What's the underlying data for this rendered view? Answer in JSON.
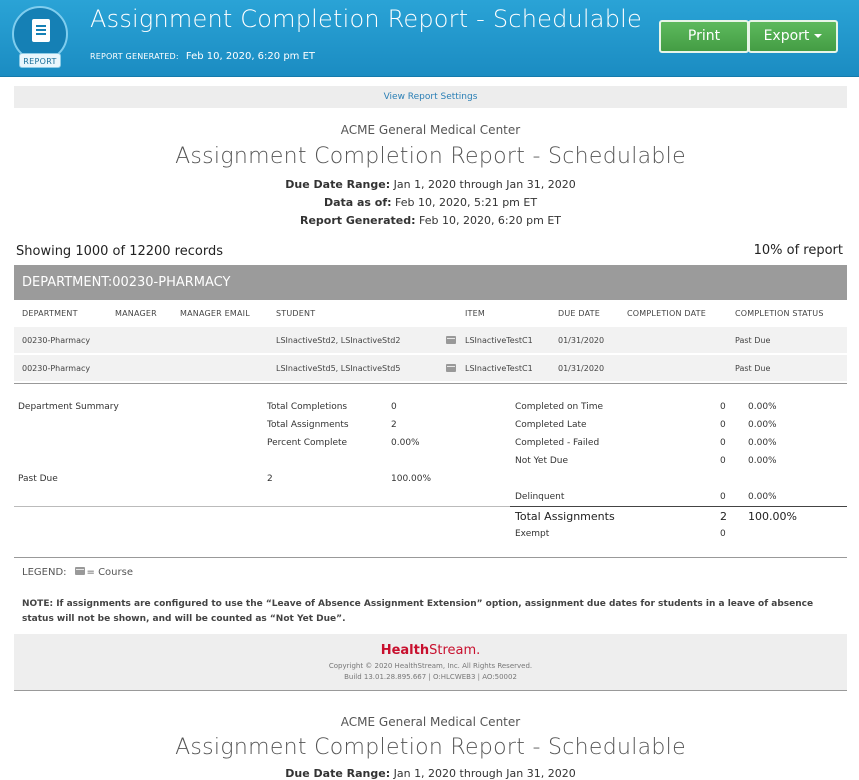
{
  "header": {
    "badge_label": "REPORT",
    "title": "Assignment Completion Report - Schedulable",
    "generated_label": "REPORT GENERATED:",
    "generated_value": "Feb 10, 2020, 6:20 pm ET",
    "print_label": "Print",
    "export_label": "Export",
    "colors": {
      "header_blue": "#1b8cc2",
      "button_green": "#449d44"
    }
  },
  "settings_link": "View Report Settings",
  "report_block": {
    "org": "ACME General Medical Center",
    "title": "Assignment Completion Report - Schedulable",
    "due_range_label": "Due Date Range:",
    "due_range_value": "Jan 1, 2020 through Jan 31, 2020",
    "data_as_of_label": "Data as of:",
    "data_as_of_value": "Feb 10, 2020, 5:21 pm ET",
    "generated_label": "Report Generated:",
    "generated_value": "Feb 10, 2020, 6:20 pm ET"
  },
  "showing": "Showing 1000 of 12200 records",
  "percent_of_report": "10% of report",
  "department_header": "DEPARTMENT:00230-PHARMACY",
  "table": {
    "columns": [
      "DEPARTMENT",
      "MANAGER",
      "MANAGER EMAIL",
      "STUDENT",
      "ITEM",
      "DUE DATE",
      "COMPLETION DATE",
      "COMPLETION STATUS"
    ],
    "rows": [
      {
        "department": "00230-Pharmacy",
        "manager": "",
        "manager_email": "",
        "student": "LSInactiveStd2, LSInactiveStd2",
        "item_icon": "book-icon",
        "item": "LSInactiveTestC1",
        "due_date": "01/31/2020",
        "completion_date": "",
        "status": "Past Due"
      },
      {
        "department": "00230-Pharmacy",
        "manager": "",
        "manager_email": "",
        "student": "LSInactiveStd5, LSInactiveStd5",
        "item_icon": "book-icon",
        "item": "LSInactiveTestC1",
        "due_date": "01/31/2020",
        "completion_date": "",
        "status": "Past Due"
      }
    ]
  },
  "summary": {
    "dept_summary_label": "Department Summary",
    "total_completions_label": "Total Completions",
    "total_completions": "0",
    "total_assignments_label": "Total Assignments",
    "total_assignments": "2",
    "percent_complete_label": "Percent Complete",
    "percent_complete": "0.00%",
    "past_due_label": "Past Due",
    "past_due_count": "2",
    "past_due_pct": "100.00%",
    "right": [
      {
        "label": "Completed on Time",
        "count": "0",
        "pct": "0.00%"
      },
      {
        "label": "Completed Late",
        "count": "0",
        "pct": "0.00%"
      },
      {
        "label": "Completed - Failed",
        "count": "0",
        "pct": "0.00%"
      },
      {
        "label": "Not Yet Due",
        "count": "0",
        "pct": "0.00%"
      },
      {
        "label": "Delinquent",
        "count": "0",
        "pct": "0.00%"
      }
    ],
    "total_label": "Total Assignments",
    "total_count": "2",
    "total_pct": "100.00%",
    "exempt_label": "Exempt",
    "exempt_count": "0"
  },
  "legend": {
    "label": "LEGEND:",
    "course_text": "= Course"
  },
  "note": "NOTE: If assignments are configured to use the “Leave of Absence Assignment Extension” option, assignment due dates for students in a leave of absence status will not be shown, and will be counted as “Not Yet Due”.",
  "footer": {
    "brand_bold": "Health",
    "brand_rest": "Stream.",
    "copyright": "Copyright © 2020 HealthStream, Inc. All Rights Reserved.",
    "build": "Build 13.01.28.895.667 | O:HLCWEB3 | AO:50002"
  },
  "second_block": {
    "org": "ACME General Medical Center",
    "title": "Assignment Completion Report - Schedulable",
    "due_range_label": "Due Date Range:",
    "due_range_value": "Jan 1, 2020 through Jan 31, 2020"
  }
}
